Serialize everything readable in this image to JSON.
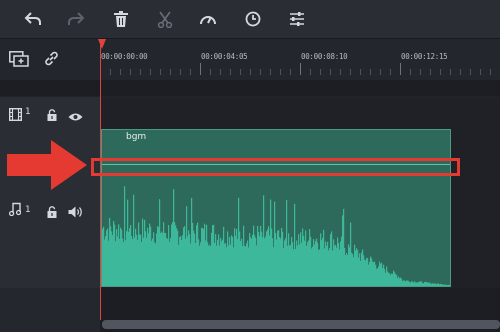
{
  "toolbar": {
    "buttons": [
      {
        "name": "undo-button",
        "icon": "undo-icon",
        "enabled": true
      },
      {
        "name": "redo-button",
        "icon": "redo-icon",
        "enabled": false
      },
      {
        "name": "delete-button",
        "icon": "trash-icon",
        "enabled": true
      },
      {
        "name": "cut-button",
        "icon": "scissors-icon",
        "enabled": false
      },
      {
        "name": "speed-button",
        "icon": "speedometer-icon",
        "enabled": true
      },
      {
        "name": "duration-button",
        "icon": "clock-icon",
        "enabled": true
      },
      {
        "name": "adjust-button",
        "icon": "sliders-icon",
        "enabled": true
      }
    ]
  },
  "ruler": {
    "timecodes": [
      "00:00:00:00",
      "00:00:04:05",
      "00:00:08:10",
      "00:00:12:15"
    ]
  },
  "tracks": {
    "video": {
      "number": "1",
      "icon": "film-icon",
      "lock_icon": "lock-icon",
      "visibility_icon": "eye-icon"
    },
    "audio": {
      "number": "1",
      "icon": "music-note-icon",
      "lock_icon": "lock-icon",
      "volume_icon": "speaker-icon"
    }
  },
  "header_icons": {
    "add_track": "add-track-icon",
    "link": "link-icon"
  },
  "clip": {
    "label": "bgm"
  },
  "colors": {
    "playhead": "#e0433b",
    "clip_fill": "#2e6a5b",
    "waveform": "#3db89a",
    "annotation": "#e53a32"
  }
}
